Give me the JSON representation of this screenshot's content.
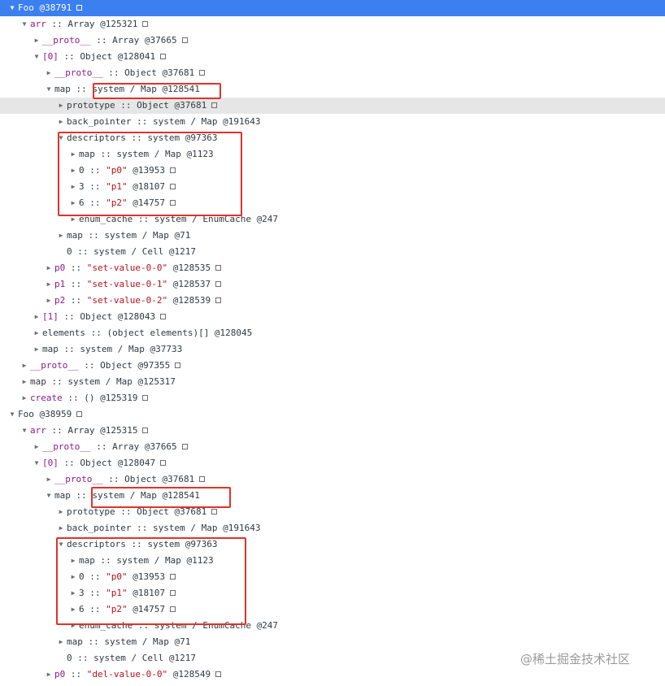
{
  "rows": [
    {
      "d": 0,
      "t": "open",
      "k": "Foo",
      "k_plain": true,
      "sep": "",
      "v": " @38791",
      "sq": true,
      "sel": true
    },
    {
      "d": 1,
      "t": "open",
      "k": "arr",
      "sep": " :: ",
      "v": "Array @125321",
      "sq": true
    },
    {
      "d": 2,
      "t": "closed",
      "k": "__proto__",
      "sep": " :: ",
      "v": "Array @37665",
      "sq": true
    },
    {
      "d": 2,
      "t": "open",
      "k": "[0]",
      "sep": " :: ",
      "v": "Object @128041",
      "sq": true
    },
    {
      "d": 3,
      "t": "closed",
      "k": "__proto__",
      "sep": " :: ",
      "v": "Object @37681",
      "sq": true
    },
    {
      "d": 3,
      "t": "open",
      "k": "map",
      "k_plain": true,
      "sep": " :: ",
      "v": "system / Map @128541"
    },
    {
      "d": 4,
      "t": "closed",
      "k": "prototype",
      "k_plain": true,
      "sep": " :: ",
      "v": "Object @37681",
      "sq": true,
      "hover": true
    },
    {
      "d": 4,
      "t": "closed",
      "k": "back_pointer",
      "k_plain": true,
      "sep": " :: ",
      "v": "system / Map @191643"
    },
    {
      "d": 4,
      "t": "open",
      "k": "descriptors",
      "k_plain": true,
      "sep": " :: ",
      "v": "system @97363"
    },
    {
      "d": 5,
      "t": "closed",
      "k": "map",
      "k_plain": true,
      "sep": " :: ",
      "v": "system / Map @1123"
    },
    {
      "d": 5,
      "t": "closed",
      "k": "0",
      "k_plain": true,
      "sep": " :: ",
      "s": "\"p0\"",
      "v": " @13953",
      "sq": true
    },
    {
      "d": 5,
      "t": "closed",
      "k": "3",
      "k_plain": true,
      "sep": " :: ",
      "s": "\"p1\"",
      "v": " @18107",
      "sq": true
    },
    {
      "d": 5,
      "t": "closed",
      "k": "6",
      "k_plain": true,
      "sep": " :: ",
      "s": "\"p2\"",
      "v": " @14757",
      "sq": true
    },
    {
      "d": 5,
      "t": "closed",
      "k": "enum_cache",
      "k_plain": true,
      "sep": " :: ",
      "v": "system / EnumCache @247"
    },
    {
      "d": 4,
      "t": "closed",
      "k": "map",
      "k_plain": true,
      "sep": " :: ",
      "v": "system / Map @71"
    },
    {
      "d": 4,
      "t": "none",
      "k": "0",
      "k_plain": true,
      "sep": " :: ",
      "v": "system / Cell @1217"
    },
    {
      "d": 3,
      "t": "closed",
      "k": "p0",
      "sep": " :: ",
      "s": "\"set-value-0-0\"",
      "v": " @128535",
      "sq": true
    },
    {
      "d": 3,
      "t": "closed",
      "k": "p1",
      "sep": " :: ",
      "s": "\"set-value-0-1\"",
      "v": " @128537",
      "sq": true
    },
    {
      "d": 3,
      "t": "closed",
      "k": "p2",
      "sep": " :: ",
      "s": "\"set-value-0-2\"",
      "v": " @128539",
      "sq": true
    },
    {
      "d": 2,
      "t": "closed",
      "k": "[1]",
      "sep": " :: ",
      "v": "Object @128043",
      "sq": true
    },
    {
      "d": 2,
      "t": "closed",
      "k": "elements",
      "k_plain": true,
      "sep": " :: ",
      "v": "(object elements)[] @128045"
    },
    {
      "d": 2,
      "t": "closed",
      "k": "map",
      "k_plain": true,
      "sep": " :: ",
      "v": "system / Map @37733"
    },
    {
      "d": 1,
      "t": "closed",
      "k": "__proto__",
      "sep": " :: ",
      "v": "Object @97355",
      "sq": true
    },
    {
      "d": 1,
      "t": "closed",
      "k": "map",
      "k_plain": true,
      "sep": " :: ",
      "v": "system / Map @125317"
    },
    {
      "d": 1,
      "t": "closed",
      "k": "create",
      "sep": " :: ",
      "v": "() @125319",
      "sq": true
    },
    {
      "d": 0,
      "t": "open",
      "k": "Foo",
      "k_plain": true,
      "sep": "",
      "v": " @38959",
      "sq": true
    },
    {
      "d": 1,
      "t": "open",
      "k": "arr",
      "sep": " :: ",
      "v": "Array @125315",
      "sq": true
    },
    {
      "d": 2,
      "t": "closed",
      "k": "__proto__",
      "sep": " :: ",
      "v": "Array @37665",
      "sq": true
    },
    {
      "d": 2,
      "t": "open",
      "k": "[0]",
      "sep": " :: ",
      "v": "Object @128047",
      "sq": true
    },
    {
      "d": 3,
      "t": "closed",
      "k": "__proto__",
      "sep": " :: ",
      "v": "Object @37681",
      "sq": true
    },
    {
      "d": 3,
      "t": "open",
      "k": "map",
      "k_plain": true,
      "sep": " :: ",
      "v": "system / Map @128541"
    },
    {
      "d": 4,
      "t": "closed",
      "k": "prototype",
      "k_plain": true,
      "sep": " :: ",
      "v": "Object @37681",
      "sq": true
    },
    {
      "d": 4,
      "t": "closed",
      "k": "back_pointer",
      "k_plain": true,
      "sep": " :: ",
      "v": "system / Map @191643"
    },
    {
      "d": 4,
      "t": "open",
      "k": "descriptors",
      "k_plain": true,
      "sep": " :: ",
      "v": "system @97363"
    },
    {
      "d": 5,
      "t": "closed",
      "k": "map",
      "k_plain": true,
      "sep": " :: ",
      "v": "system / Map @1123"
    },
    {
      "d": 5,
      "t": "closed",
      "k": "0",
      "k_plain": true,
      "sep": " :: ",
      "s": "\"p0\"",
      "v": " @13953",
      "sq": true
    },
    {
      "d": 5,
      "t": "closed",
      "k": "3",
      "k_plain": true,
      "sep": " :: ",
      "s": "\"p1\"",
      "v": " @18107",
      "sq": true
    },
    {
      "d": 5,
      "t": "closed",
      "k": "6",
      "k_plain": true,
      "sep": " :: ",
      "s": "\"p2\"",
      "v": " @14757",
      "sq": true
    },
    {
      "d": 5,
      "t": "closed",
      "k": "enum_cache",
      "k_plain": true,
      "sep": " :: ",
      "v": "system / EnumCache @247"
    },
    {
      "d": 4,
      "t": "closed",
      "k": "map",
      "k_plain": true,
      "sep": " :: ",
      "v": "system / Map @71"
    },
    {
      "d": 4,
      "t": "none",
      "k": "0",
      "k_plain": true,
      "sep": " :: ",
      "v": "system / Cell @1217"
    },
    {
      "d": 3,
      "t": "closed",
      "k": "p0",
      "sep": " :: ",
      "s": "\"del-value-0-0\"",
      "v": " @128549",
      "sq": true
    }
  ],
  "watermark": "@稀土掘金技术社区",
  "colors": {
    "selected_row": "#3c7ff0",
    "key": "#8b1c8a",
    "string": "#b5121b",
    "annotation_box": "#e1312c"
  }
}
